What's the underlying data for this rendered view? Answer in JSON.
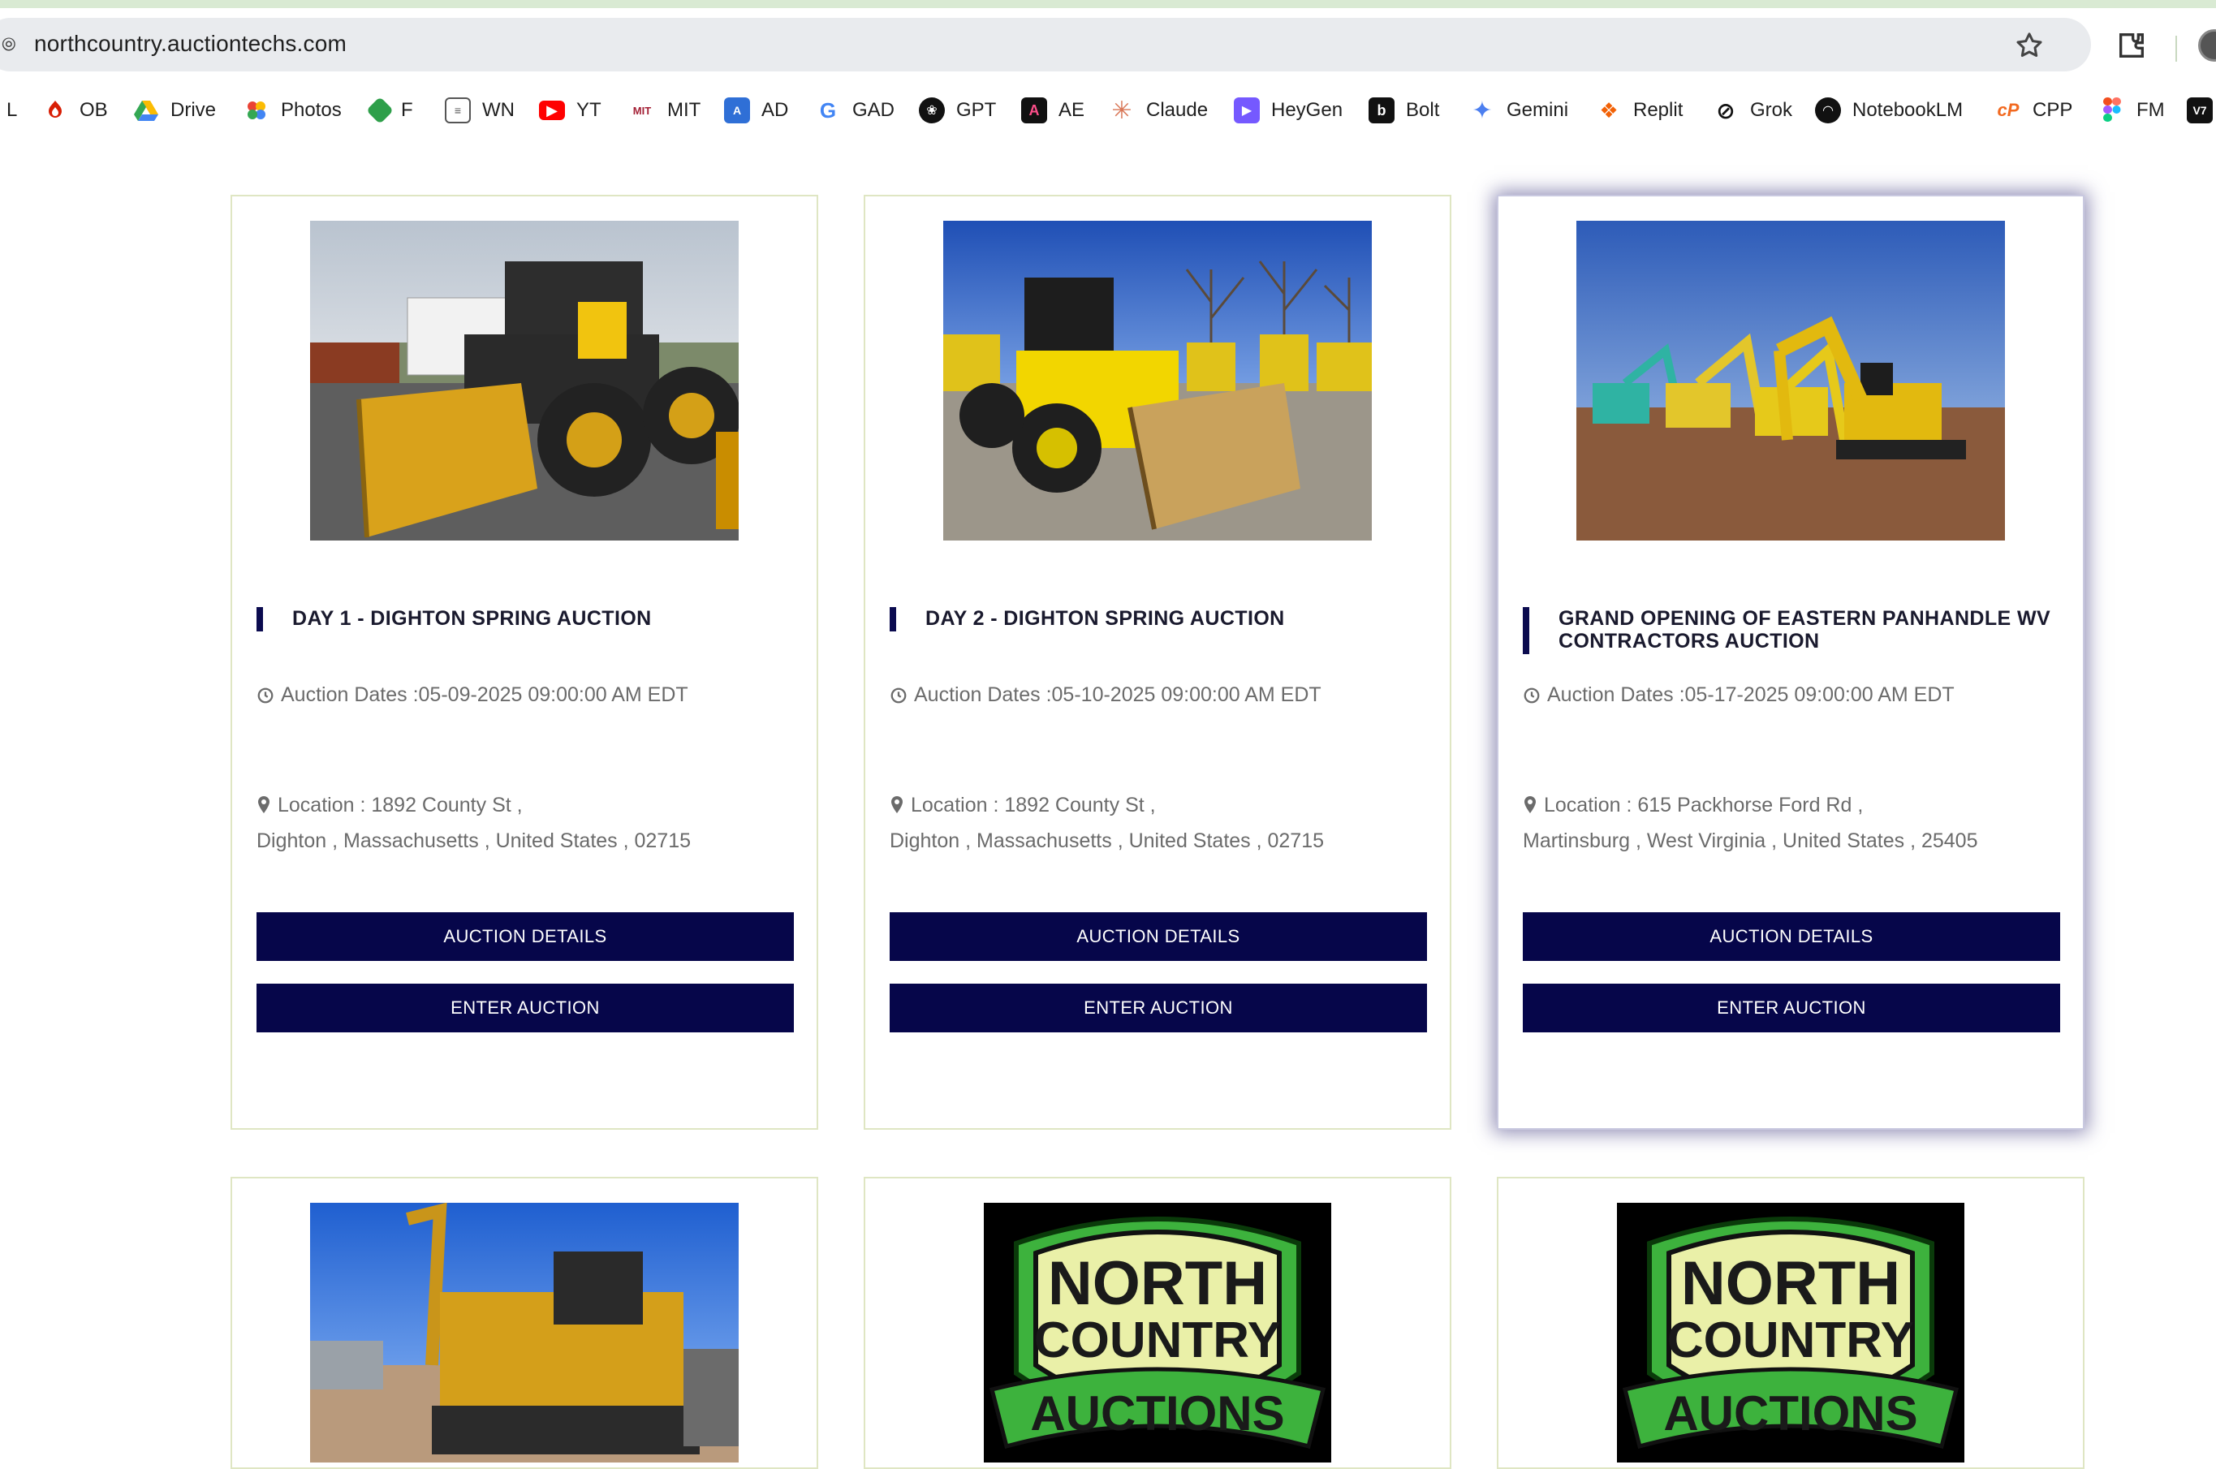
{
  "browser": {
    "url": "northcountry.auctiontechs.com",
    "bookmarks": [
      {
        "label": "L",
        "icon": "bookmark-l-icon"
      },
      {
        "label": "OB",
        "icon": "santander-icon"
      },
      {
        "label": "Drive",
        "icon": "google-drive-icon"
      },
      {
        "label": "Photos",
        "icon": "google-photos-icon"
      },
      {
        "label": "F",
        "icon": "f-icon"
      },
      {
        "label": "WN",
        "icon": "wn-icon"
      },
      {
        "label": "YT",
        "icon": "youtube-icon"
      },
      {
        "label": "MIT",
        "icon": "mit-icon"
      },
      {
        "label": "AD",
        "icon": "ad-icon"
      },
      {
        "label": "GAD",
        "icon": "google-icon"
      },
      {
        "label": "GPT",
        "icon": "openai-icon"
      },
      {
        "label": "AE",
        "icon": "adobe-icon"
      },
      {
        "label": "Claude",
        "icon": "claude-icon"
      },
      {
        "label": "HeyGen",
        "icon": "heygen-icon"
      },
      {
        "label": "Bolt",
        "icon": "bolt-icon"
      },
      {
        "label": "Gemini",
        "icon": "gemini-icon"
      },
      {
        "label": "Replit",
        "icon": "replit-icon"
      },
      {
        "label": "Grok",
        "icon": "grok-icon"
      },
      {
        "label": "NotebookLM",
        "icon": "notebooklm-icon"
      },
      {
        "label": "CPP",
        "icon": "cpp-icon"
      },
      {
        "label": "FM",
        "icon": "figma-icon"
      },
      {
        "label": "",
        "icon": "v7-icon"
      }
    ]
  },
  "auctions": [
    {
      "title": "DAY 1 - DIGHTON SPRING AUCTION",
      "dates": "Auction Dates :05-09-2025 09:00:00 AM EDT",
      "location_line1": "Location : 1892 County St ,",
      "location_line2": "Dighton ,  Massachusetts , United States , 02715",
      "details_label": "AUCTION DETAILS",
      "enter_label": "ENTER AUCTION"
    },
    {
      "title": "DAY 2 - DIGHTON SPRING AUCTION",
      "dates": "Auction Dates :05-10-2025 09:00:00 AM EDT",
      "location_line1": "Location : 1892 County St ,",
      "location_line2": "Dighton ,  Massachusetts , United States , 02715",
      "details_label": "AUCTION DETAILS",
      "enter_label": "ENTER AUCTION"
    },
    {
      "title": "GRAND OPENING OF EASTERN PANHANDLE WV CONTRACTORS AUCTION",
      "dates": "Auction Dates :05-17-2025 09:00:00 AM EDT",
      "location_line1": "Location : 615 Packhorse Ford Rd ,",
      "location_line2": "Martinsburg ,  West Virginia , United States , 25405",
      "details_label": "AUCTION DETAILS",
      "enter_label": "ENTER AUCTION"
    }
  ],
  "logo_text": {
    "line1": "NORTH",
    "line2": "COUNTRY",
    "line3": "AUCTIONS"
  },
  "colors": {
    "button_bg": "#06064a",
    "title_bar": "#0b0b4f",
    "card_border": "#dfe6c3",
    "logo_green": "#3db23d"
  }
}
